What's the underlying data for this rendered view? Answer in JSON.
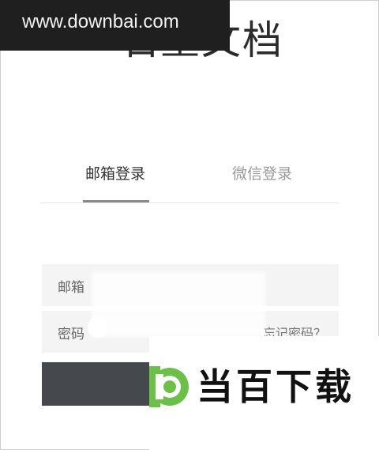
{
  "header": {
    "title": "石墨文档"
  },
  "watermark": {
    "top_text": "www.downbai.com",
    "bottom_text": "当百下载"
  },
  "tabs": [
    {
      "label": "邮箱登录",
      "active": true
    },
    {
      "label": "微信登录",
      "active": false
    }
  ],
  "form": {
    "email_label": "邮箱",
    "email_value": "",
    "password_label": "密码",
    "password_value": "",
    "forgot_label": "忘记密码？",
    "submit_label": ""
  },
  "colors": {
    "submit_bg": "#45484d",
    "field_bg": "#f4f4f4",
    "logo_green": "#6cc04a"
  }
}
